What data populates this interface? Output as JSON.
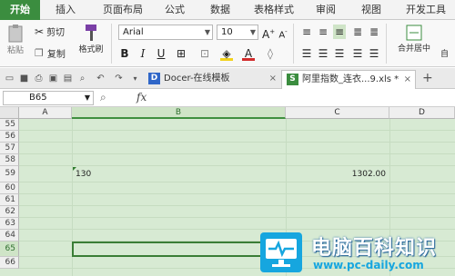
{
  "ribbon": {
    "tabs": [
      "开始",
      "插入",
      "页面布局",
      "公式",
      "数据",
      "表格样式",
      "审阅",
      "视图",
      "开发工具"
    ],
    "active_tab": "开始",
    "paste_label": "粘贴",
    "cut_label": "剪切",
    "copy_label": "复制",
    "format_painter_label": "格式刷",
    "font_name": "Arial",
    "font_size": "10",
    "merge_center_label": "合并居中",
    "more_label": "自"
  },
  "quickbar": {
    "docer_tab": "Docer-在线模板",
    "file_tab": "阿里指数_连衣...9.xls *",
    "add_tab_symbol": "+"
  },
  "formula_bar": {
    "name_box": "B65",
    "fx_label": "fx",
    "formula": ""
  },
  "sheet": {
    "columns": [
      "A",
      "B",
      "C",
      "D"
    ],
    "selected_column": "B",
    "rows": [
      {
        "num": "55",
        "A": "",
        "B": "",
        "C": ""
      },
      {
        "num": "56",
        "A": "",
        "B": "",
        "C": ""
      },
      {
        "num": "57",
        "A": "",
        "B": "",
        "C": ""
      },
      {
        "num": "58",
        "A": "",
        "B": "",
        "C": ""
      },
      {
        "num": "59",
        "A": "",
        "B": "130",
        "C": "1302.00"
      },
      {
        "num": "60",
        "A": "",
        "B": "",
        "C": ""
      },
      {
        "num": "61",
        "A": "",
        "B": "",
        "C": ""
      },
      {
        "num": "62",
        "A": "",
        "B": "",
        "C": ""
      },
      {
        "num": "63",
        "A": "",
        "B": "",
        "C": ""
      },
      {
        "num": "64",
        "A": "",
        "B": "",
        "C": ""
      },
      {
        "num": "65",
        "A": "",
        "B": "",
        "C": ""
      },
      {
        "num": "66",
        "A": "",
        "B": "",
        "C": ""
      }
    ],
    "selected_row": "65"
  },
  "watermark": {
    "title": "电脑百科知识",
    "url": "www.pc-daily.com"
  },
  "colors": {
    "accent": "#3b8d3f",
    "sheet_bg": "#d7ead3",
    "watermark_blue": "#16a6df"
  }
}
